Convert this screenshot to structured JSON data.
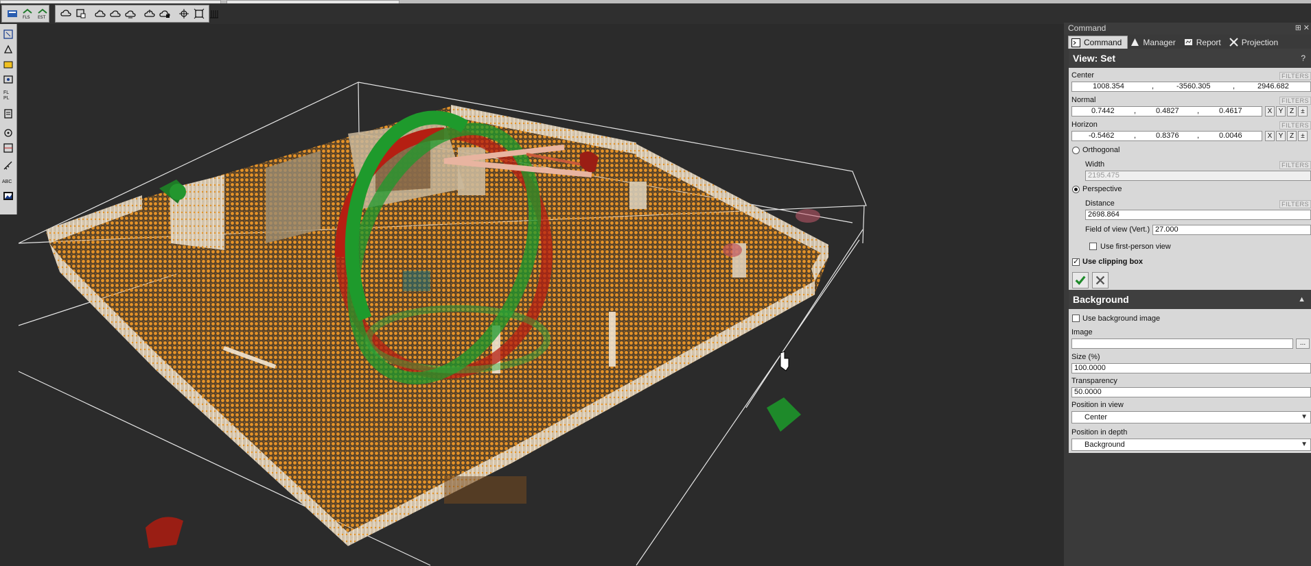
{
  "colors": {
    "panel_header": "#3f3f3f",
    "panel_body": "#d8d8d8",
    "viewport_bg": "#2b2b2b",
    "points_orange": "#e8962a",
    "gizmo_green": "#1e9a2c",
    "gizmo_red": "#b51f12"
  },
  "toolbar_icons": [
    "layers-icon",
    "fls-icon",
    "est-icon",
    "cloud-dropdown-icon",
    "cloud-select-icon",
    "cloud-add-icon",
    "cloud-edit-icon",
    "cloud-remove-icon",
    "cloud-up-icon",
    "cloud-down-icon",
    "crosshair-icon",
    "fit-icon",
    "grid-icon"
  ],
  "vtoolbar_icons": [
    "pick-icon",
    "shape-icon",
    "layer-icon",
    "cloud-icon",
    "fl-icon",
    "scan-icon",
    "target-icon",
    "section-icon",
    "measure-icon",
    "abc-icon",
    "image-icon"
  ],
  "panel": {
    "title": "Command",
    "tabs": [
      {
        "label": "Command",
        "icon": "terminal-icon"
      },
      {
        "label": "Manager",
        "icon": "manager-icon"
      },
      {
        "label": "Report",
        "icon": "report-icon"
      },
      {
        "label": "Projection",
        "icon": "projection-icon"
      }
    ]
  },
  "view_set": {
    "title": "View: Set",
    "help": "?",
    "filters": "FILTERS",
    "center": {
      "label": "Center",
      "x": "1008.354",
      "y": "-3560.305",
      "z": "2946.682"
    },
    "normal": {
      "label": "Normal",
      "x": "0.7442",
      "y": "0.4827",
      "z": "0.4617"
    },
    "horizon": {
      "label": "Horizon",
      "x": "-0.5462",
      "y": "0.8376",
      "z": "0.0046"
    },
    "axis_buttons": [
      "X",
      "Y",
      "Z",
      "±"
    ],
    "orthogonal": {
      "label": "Orthogonal",
      "selected": false
    },
    "width": {
      "label": "Width",
      "value": "2195.475"
    },
    "perspective": {
      "label": "Perspective",
      "selected": true
    },
    "distance": {
      "label": "Distance",
      "value": "2698.864"
    },
    "fov": {
      "label": "Field of view (Vert.)",
      "value": "27.000"
    },
    "first_person": {
      "label": "Use first-person view",
      "checked": false
    },
    "clipping": {
      "label": "Use clipping box",
      "checked": true
    }
  },
  "background": {
    "title": "Background",
    "use_image": {
      "label": "Use background image",
      "checked": false
    },
    "image": {
      "label": "Image",
      "value": "",
      "browse": "..."
    },
    "size": {
      "label": "Size (%)",
      "value": "100.0000"
    },
    "transparency": {
      "label": "Transparency",
      "value": "50.0000"
    },
    "position_view": {
      "label": "Position in view",
      "value": "Center"
    },
    "position_depth": {
      "label": "Position in depth",
      "value": "Background"
    }
  }
}
